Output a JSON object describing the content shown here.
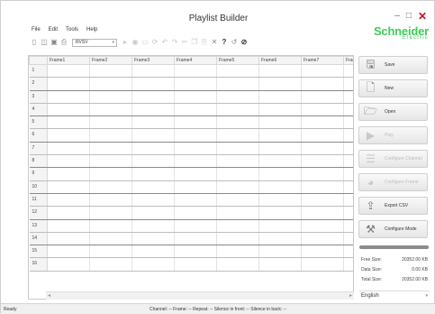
{
  "window": {
    "title": "Playlist Builder"
  },
  "menu": [
    "File",
    "Edit",
    "Tools",
    "Help"
  ],
  "toolbar": {
    "select_value": "RVSV"
  },
  "logo": {
    "line1": "Schneider",
    "line2": "Electric"
  },
  "grid": {
    "columns": [
      "Frame1",
      "Frame2",
      "Frame3",
      "Frame4",
      "Frame5",
      "Frame6",
      "Frame7",
      "Fram"
    ],
    "rows": [
      "1",
      "2",
      "3",
      "4",
      "5",
      "6",
      "7",
      "8",
      "9",
      "10",
      "11",
      "12",
      "13",
      "14",
      "15",
      "16"
    ]
  },
  "buttons": [
    {
      "label": "Save",
      "icon": "save-icon",
      "enabled": true
    },
    {
      "label": "New",
      "icon": "new-document-icon",
      "enabled": true
    },
    {
      "label": "Open",
      "icon": "open-folder-icon",
      "enabled": true
    },
    {
      "label": "Play",
      "icon": "play-icon",
      "enabled": false
    },
    {
      "label": "Configure Channel",
      "icon": "channel-icon",
      "enabled": false
    },
    {
      "label": "Configure Frame",
      "icon": "frame-icon",
      "enabled": false
    },
    {
      "label": "Export CSV",
      "icon": "export-icon",
      "enabled": true
    },
    {
      "label": "Configure Mode",
      "icon": "tools-icon",
      "enabled": true
    }
  ],
  "sizes": {
    "free_label": "Free Size:",
    "free_value": "20352.00 KB",
    "data_label": "Data Size:",
    "data_value": "0.00 KB",
    "total_label": "Total Size:",
    "total_value": "20352.00 KB"
  },
  "language": "English",
  "status": {
    "ready": "Ready",
    "info": "Channel: --  Frame: --  Repeat: --  Silence in front: --  Silence in back: --"
  }
}
